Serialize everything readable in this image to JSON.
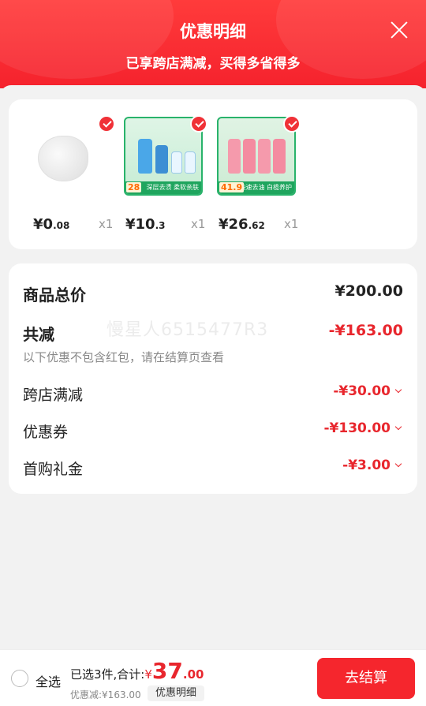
{
  "header": {
    "title": "优惠明细",
    "subtitle": "已享跨店满减，买得多省得多"
  },
  "products": [
    {
      "price_int": "¥0",
      "price_dec": ".08",
      "qty": "x1",
      "image": "cotton-pad"
    },
    {
      "price_int": "¥10",
      "price_dec": ".3",
      "qty": "x1",
      "image": "detergent-bottles",
      "tag": "28",
      "band": "深层去渍 柔软亲肤"
    },
    {
      "price_int": "¥26",
      "price_dec": ".62",
      "qty": "x1",
      "image": "pink-bottles",
      "tag": "41.9",
      "band": "快速去油 白榄养护"
    }
  ],
  "summary": {
    "total_label": "商品总价",
    "total_value": "¥200.00",
    "discount_label": "共减",
    "discount_value": "-¥163.00",
    "note": "以下优惠不包含红包，请在结算页查看",
    "watermark": "慢星人6515477R3",
    "items": [
      {
        "label": "跨店满减",
        "value": "-¥30.00"
      },
      {
        "label": "优惠券",
        "value": "-¥130.00"
      },
      {
        "label": "首购礼金",
        "value": "-¥3.00"
      }
    ]
  },
  "footer": {
    "select_all": "全选",
    "selected_text": "已选3件,合计:",
    "currency": "¥",
    "total_int": "37",
    "total_dec": ".00",
    "saved_text": "优惠减:¥163.00",
    "detail_button": "优惠明细",
    "checkout_button": "去结算"
  },
  "colors": {
    "accent": "#f5222d",
    "price_red": "#e8262d"
  }
}
